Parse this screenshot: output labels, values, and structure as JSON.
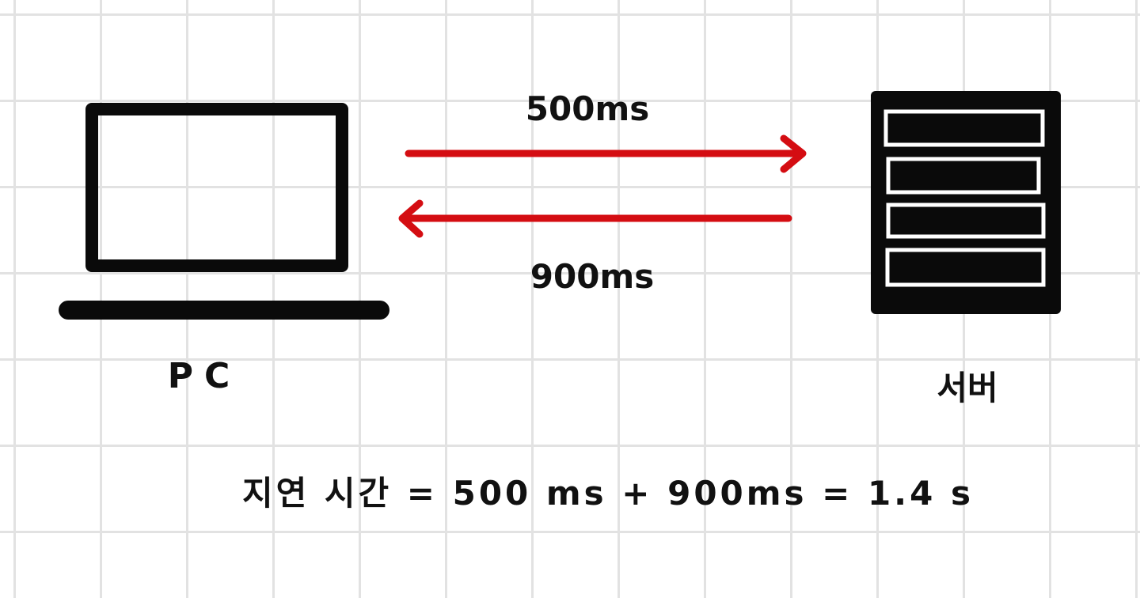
{
  "colors": {
    "ink": "#0a0a0a",
    "arrow": "#d40d12",
    "grid": "#e2e2e2",
    "paper": "#ffffff"
  },
  "nodes": {
    "pc": {
      "icon": "laptop-icon",
      "label": "PC"
    },
    "server": {
      "icon": "server-rack-icon",
      "label": "서버"
    }
  },
  "arrows": {
    "request": {
      "direction": "pc-to-server",
      "label": "500ms"
    },
    "response": {
      "direction": "server-to-pc",
      "label": "900ms"
    }
  },
  "formula": {
    "text": "지연 시간 = 500 ms + 900ms = 1.4 s"
  }
}
